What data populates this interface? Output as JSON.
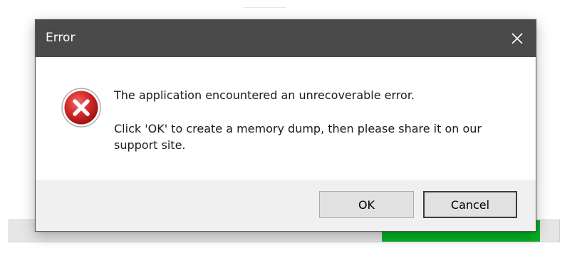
{
  "dialog": {
    "title": "Error",
    "close_icon": "close-icon",
    "icon": "error-icon",
    "message_line1": "The application encountered an unrecoverable error.",
    "message_line2": "Click 'OK' to create a memory dump, then please share it on our support site.",
    "ok_label": "OK",
    "cancel_label": "Cancel"
  },
  "colors": {
    "titlebar": "#4a4a4a",
    "footer": "#f0f0f0",
    "error_red": "#d42a2a",
    "progress_green": "#06b025"
  }
}
